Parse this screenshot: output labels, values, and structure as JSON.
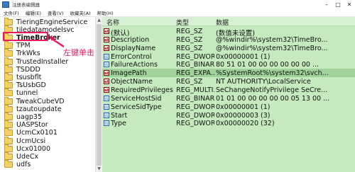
{
  "window": {
    "title": "注册表编辑器"
  },
  "menu": [
    "文件(F)",
    "编辑(E)",
    "查看(V)",
    "收藏夹(A)",
    "帮助(H)"
  ],
  "tree": {
    "items": [
      {
        "label": "TieringEngineService"
      },
      {
        "label": "tiledatamodelsvc"
      },
      {
        "label": "TimeBroker",
        "selected": true
      },
      {
        "label": "TPM"
      },
      {
        "label": "TrkWks"
      },
      {
        "label": "TrustedInstaller"
      },
      {
        "label": "TSDDD"
      },
      {
        "label": "tsusbflt"
      },
      {
        "label": "TsUsbGD"
      },
      {
        "label": "tunnel"
      },
      {
        "label": "TweakCubeVD"
      },
      {
        "label": "tzautoupdate"
      },
      {
        "label": "uagp35"
      },
      {
        "label": "UASPStor"
      },
      {
        "label": "UcmCx0101"
      },
      {
        "label": "UcmUcsi"
      },
      {
        "label": "Ucx01000"
      },
      {
        "label": "UdeCx"
      },
      {
        "label": "udfs"
      }
    ]
  },
  "annotation": {
    "text": "左键单击",
    "color": "#e8195f"
  },
  "values": {
    "headers": {
      "name": "名称",
      "type": "类型",
      "data": "数据"
    },
    "rows": [
      {
        "icon": "string-value-icon",
        "name": "(默认)",
        "type": "REG_SZ",
        "data": "(数值未设置)"
      },
      {
        "icon": "string-value-icon",
        "name": "Description",
        "type": "REG_SZ",
        "data": "@%windir%\\system32\\TimeBro..."
      },
      {
        "icon": "string-value-icon",
        "name": "DisplayName",
        "type": "REG_SZ",
        "data": "@%windir%\\system32\\TimeBro..."
      },
      {
        "icon": "binary-value-icon",
        "name": "ErrorControl",
        "type": "REG_DWORD",
        "data": "0x00000001 (1)"
      },
      {
        "icon": "binary-value-icon",
        "name": "FailureActions",
        "type": "REG_BINARY",
        "data": "80 51 01 00 00 00 00 00 00 ..."
      },
      {
        "icon": "string-value-icon",
        "name": "ImagePath",
        "type": "REG_EXPA...",
        "data": "%SystemRoot%\\system32\\svch...",
        "selected": true
      },
      {
        "icon": "string-value-icon",
        "name": "ObjectName",
        "type": "REG_SZ",
        "data": "NT AUTHORITY\\LocalService"
      },
      {
        "icon": "string-value-icon",
        "name": "RequiredPrivileges",
        "type": "REG_MULTI...",
        "data": "SeChangeNotifyPrivilege SeCre..."
      },
      {
        "icon": "binary-value-icon",
        "name": "ServiceHostSid",
        "type": "REG_BINARY",
        "data": "01 01 00 00 00 00 00 05 13 00 ..."
      },
      {
        "icon": "binary-value-icon",
        "name": "ServiceSidType",
        "type": "REG_DWORD",
        "data": "0x00000001 (1)"
      },
      {
        "icon": "binary-value-icon",
        "name": "Start",
        "type": "REG_DWORD",
        "data": "0x00000003 (3)"
      },
      {
        "icon": "binary-value-icon",
        "name": "Type",
        "type": "REG_DWORD",
        "data": "0x00000020 (32)"
      }
    ]
  }
}
